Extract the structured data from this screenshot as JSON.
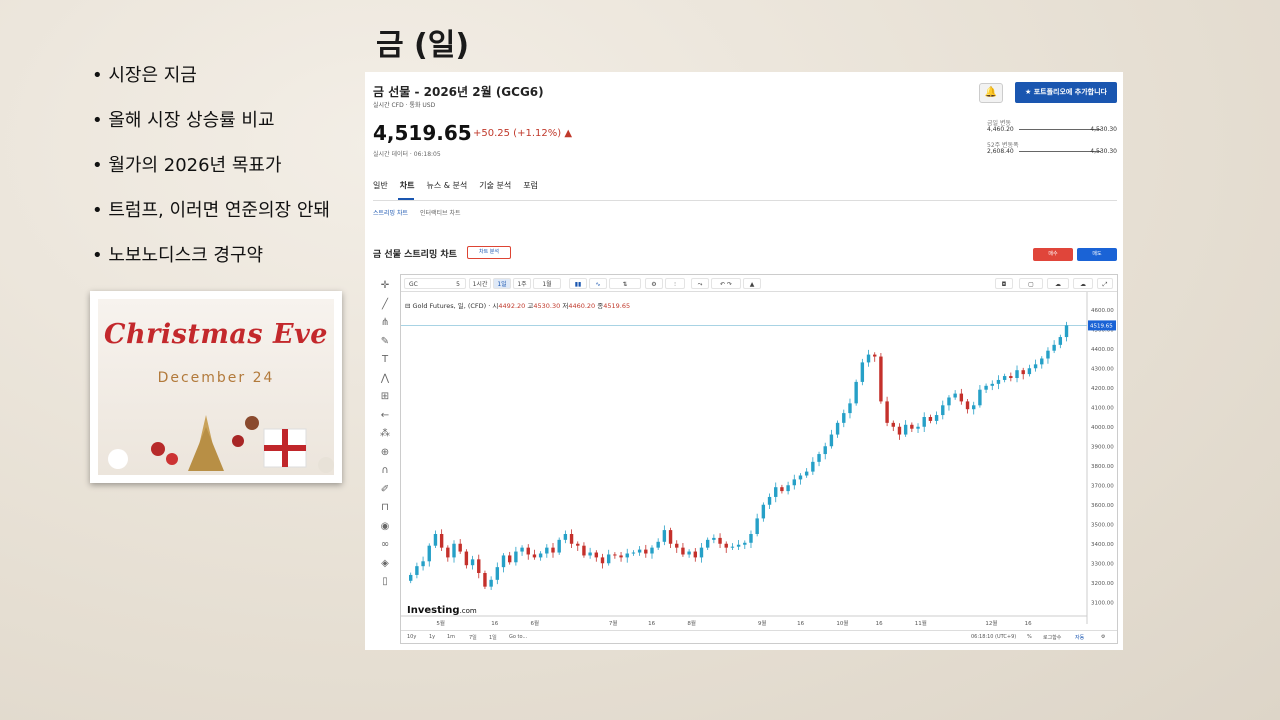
{
  "slide": {
    "title": "금 (일)",
    "bullets": [
      "시장은 지금",
      "올해 시장 상승률 비교",
      "월가의 2026년 목표가",
      "트럼프, 이러면 연준의장 안돼",
      "노보노디스크 경구약"
    ],
    "card_title": "Christmas Eve",
    "card_date": "December 24"
  },
  "header": {
    "title": "금 선물 - 2026년 2월 (GCG6)",
    "meta": "실시간 CFD · 통화 USD",
    "portfolio_button": "포트폴리오에 추가합니다",
    "price": "4,519.65",
    "change": "+50.25 (+1.12%) ▲",
    "live_time": "실시간 데이터 · 06:18:05"
  },
  "ranges": {
    "day_label": "금일 변동",
    "day_low": "4,460.20",
    "day_high": "4,530.30",
    "week52_label": "52주 변동폭",
    "week52_low": "2,608.40",
    "week52_high": "4,530.30"
  },
  "tabs": [
    "일반",
    "차트",
    "뉴스 & 분석",
    "기술 분석",
    "포럼"
  ],
  "subtabs": [
    "스트리밍 차트",
    "인터랙티브 차트"
  ],
  "chart_header": {
    "title": "금 선물 스트리밍 차트",
    "analysis_button": "차트 분석",
    "buy": "매수",
    "sell": "매도"
  },
  "toolbar": {
    "symbol": "GC",
    "count": "5",
    "intervals": [
      "1시간",
      "1일",
      "1주",
      "1월"
    ]
  },
  "legend": {
    "name": "Gold Futures, 일, (CFD)",
    "open_label": "시",
    "open": "4492.20",
    "high_label": "고",
    "high": "4530.30",
    "low_label": "저",
    "low": "4460.20",
    "close_label": "종",
    "close": "4519.65"
  },
  "watermark": "Investing",
  "watermark_suffix": ".com",
  "bottom": {
    "ranges": [
      "10y",
      "1y",
      "1m",
      "7일",
      "1일",
      "Go to..."
    ],
    "time": "06:18:10 (UTC+9)",
    "pct": "%",
    "log": "로그함수",
    "auto": "자동"
  },
  "chart_data": {
    "type": "candlestick",
    "title": "Gold Futures, 일, (CFD)",
    "ylim": [
      3050,
      4650
    ],
    "y_ticks": [
      3100,
      3200,
      3300,
      3400,
      3500,
      3600,
      3700,
      3800,
      3900,
      4000,
      4100,
      4200,
      4300,
      4400,
      4500,
      4600
    ],
    "y_tick_labels": [
      "3100.00",
      "3200.00",
      "3300.00",
      "3400.00",
      "3500.00",
      "3600.00",
      "3700.00",
      "3800.00",
      "3900.00",
      "4000.00",
      "4100.00",
      "4200.00",
      "4300.00",
      "4400.00",
      "4500.00",
      "4600.00"
    ],
    "x_labels": [
      "5월",
      "16",
      "6월",
      "7월",
      "16",
      "8월",
      "9월",
      "16",
      "10월",
      "16",
      "11월",
      "12월",
      "16"
    ],
    "last_price_label": "4519.65",
    "series": [
      {
        "name": "Gold Futures",
        "close": [
          3240,
          3285,
          3310,
          3390,
          3450,
          3380,
          3330,
          3400,
          3360,
          3290,
          3320,
          3250,
          3180,
          3215,
          3280,
          3340,
          3305,
          3360,
          3380,
          3345,
          3330,
          3350,
          3380,
          3355,
          3420,
          3450,
          3400,
          3390,
          3340,
          3355,
          3330,
          3300,
          3345,
          3340,
          3330,
          3350,
          3355,
          3370,
          3350,
          3380,
          3410,
          3470,
          3400,
          3380,
          3345,
          3360,
          3330,
          3380,
          3420,
          3430,
          3400,
          3380,
          3385,
          3395,
          3405,
          3450,
          3530,
          3600,
          3640,
          3690,
          3670,
          3700,
          3730,
          3750,
          3770,
          3820,
          3860,
          3900,
          3960,
          4020,
          4070,
          4120,
          4230,
          4330,
          4370,
          4360,
          4130,
          4020,
          4000,
          3960,
          4010,
          3990,
          4000,
          4050,
          4030,
          4060,
          4110,
          4150,
          4170,
          4130,
          4090,
          4110,
          4190,
          4210,
          4220,
          4240,
          4260,
          4250,
          4290,
          4270,
          4300,
          4320,
          4350,
          4390,
          4420,
          4460,
          4519.65
        ]
      }
    ]
  }
}
